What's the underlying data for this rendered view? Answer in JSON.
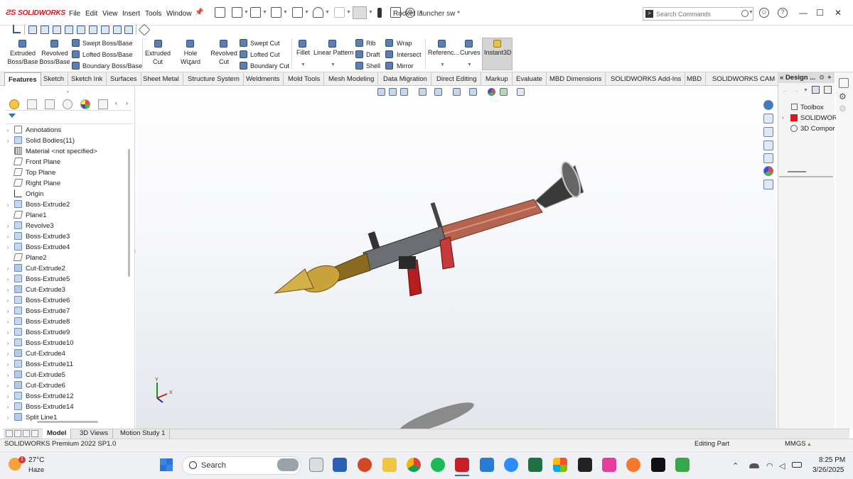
{
  "app": {
    "name": "SOLIDWORKS",
    "title": "Rocket launcher sw *"
  },
  "menu": [
    "File",
    "Edit",
    "View",
    "Insert",
    "Tools",
    "Window"
  ],
  "search": {
    "placeholder": "Search Commands"
  },
  "ribbon": {
    "extruded_boss": "Extruded Boss/Base",
    "revolved_boss": "Revolved Boss/Base",
    "swept_boss": "Swept Boss/Base",
    "lofted_boss": "Lofted Boss/Base",
    "boundary_boss": "Boundary Boss/Base",
    "extruded_cut": "Extruded Cut",
    "hole_wizard": "Hole Wizard",
    "revolved_cut": "Revolved Cut",
    "swept_cut": "Swept Cut",
    "lofted_cut": "Lofted Cut",
    "boundary_cut": "Boundary Cut",
    "fillet": "Fillet",
    "linear_pattern": "Linear Pattern",
    "rib": "Rib",
    "draft": "Draft",
    "shell": "Shell",
    "wrap": "Wrap",
    "intersect": "Intersect",
    "mirror": "Mirror",
    "reference": "Referenc...",
    "curves": "Curves",
    "instant3d": "Instant3D"
  },
  "tabs": [
    "Features",
    "Sketch",
    "Sketch Ink",
    "Surfaces",
    "Sheet Metal",
    "Structure System",
    "Weldments",
    "Mold Tools",
    "Mesh Modeling",
    "Data Migration",
    "Direct Editing",
    "Markup",
    "Evaluate",
    "MBD Dimensions",
    "SOLIDWORKS Add-Ins",
    "MBD",
    "SOLIDWORKS CAM"
  ],
  "tree": [
    {
      "label": "Annotations",
      "icon": "anno",
      "arrow": true
    },
    {
      "label": "Solid Bodies(11)",
      "icon": "body",
      "arrow": true
    },
    {
      "label": "Material <not specified>",
      "icon": "mat",
      "arrow": false
    },
    {
      "label": "Front Plane",
      "icon": "plane",
      "arrow": false
    },
    {
      "label": "Top Plane",
      "icon": "plane",
      "arrow": false
    },
    {
      "label": "Right Plane",
      "icon": "plane",
      "arrow": false
    },
    {
      "label": "Origin",
      "icon": "origin",
      "arrow": false
    },
    {
      "label": "Boss-Extrude2",
      "icon": "body",
      "arrow": true
    },
    {
      "label": "Plane1",
      "icon": "plane",
      "arrow": false
    },
    {
      "label": "Revolve3",
      "icon": "body",
      "arrow": true
    },
    {
      "label": "Boss-Extrude3",
      "icon": "body",
      "arrow": true
    },
    {
      "label": "Boss-Extrude4",
      "icon": "body",
      "arrow": true
    },
    {
      "label": "Plane2",
      "icon": "plane",
      "arrow": false
    },
    {
      "label": "Cut-Extrude2",
      "icon": "cut",
      "arrow": true
    },
    {
      "label": "Boss-Extrude5",
      "icon": "body",
      "arrow": true
    },
    {
      "label": "Cut-Extrude3",
      "icon": "cut",
      "arrow": true
    },
    {
      "label": "Boss-Extrude6",
      "icon": "body",
      "arrow": true
    },
    {
      "label": "Boss-Extrude7",
      "icon": "body",
      "arrow": true
    },
    {
      "label": "Boss-Extrude8",
      "icon": "body",
      "arrow": true
    },
    {
      "label": "Boss-Extrude9",
      "icon": "body",
      "arrow": true
    },
    {
      "label": "Boss-Extrude10",
      "icon": "body",
      "arrow": true
    },
    {
      "label": "Cut-Extrude4",
      "icon": "cut",
      "arrow": true
    },
    {
      "label": "Boss-Extrude11",
      "icon": "body",
      "arrow": true
    },
    {
      "label": "Cut-Extrude5",
      "icon": "cut",
      "arrow": true
    },
    {
      "label": "Cut-Extrude6",
      "icon": "cut",
      "arrow": true
    },
    {
      "label": "Boss-Extrude12",
      "icon": "body",
      "arrow": true
    },
    {
      "label": "Boss-Extrude14",
      "icon": "body",
      "arrow": true
    },
    {
      "label": "Split Line1",
      "icon": "cut",
      "arrow": true
    }
  ],
  "taskpane": {
    "header": "Design ...",
    "items": [
      "Toolbox",
      "SOLIDWOR",
      "3D Compor"
    ]
  },
  "bottom_tabs": [
    "Model",
    "3D Views",
    "Motion Study 1"
  ],
  "status": {
    "left": "SOLIDWORKS Premium 2022 SP1.0",
    "mode": "Editing Part",
    "units": "MMGS"
  },
  "taskbar": {
    "temp": "27°C",
    "weather": "Haze",
    "badge": "1",
    "search": "Search",
    "time": "8:25 PM",
    "date": "3/26/2025"
  },
  "triad": {
    "x": "X",
    "y": "Y"
  },
  "colors": {
    "accent": "#d71920",
    "tab_active": "#ffffff",
    "warhead": "#c8a23a",
    "tube": "#b5654f"
  }
}
